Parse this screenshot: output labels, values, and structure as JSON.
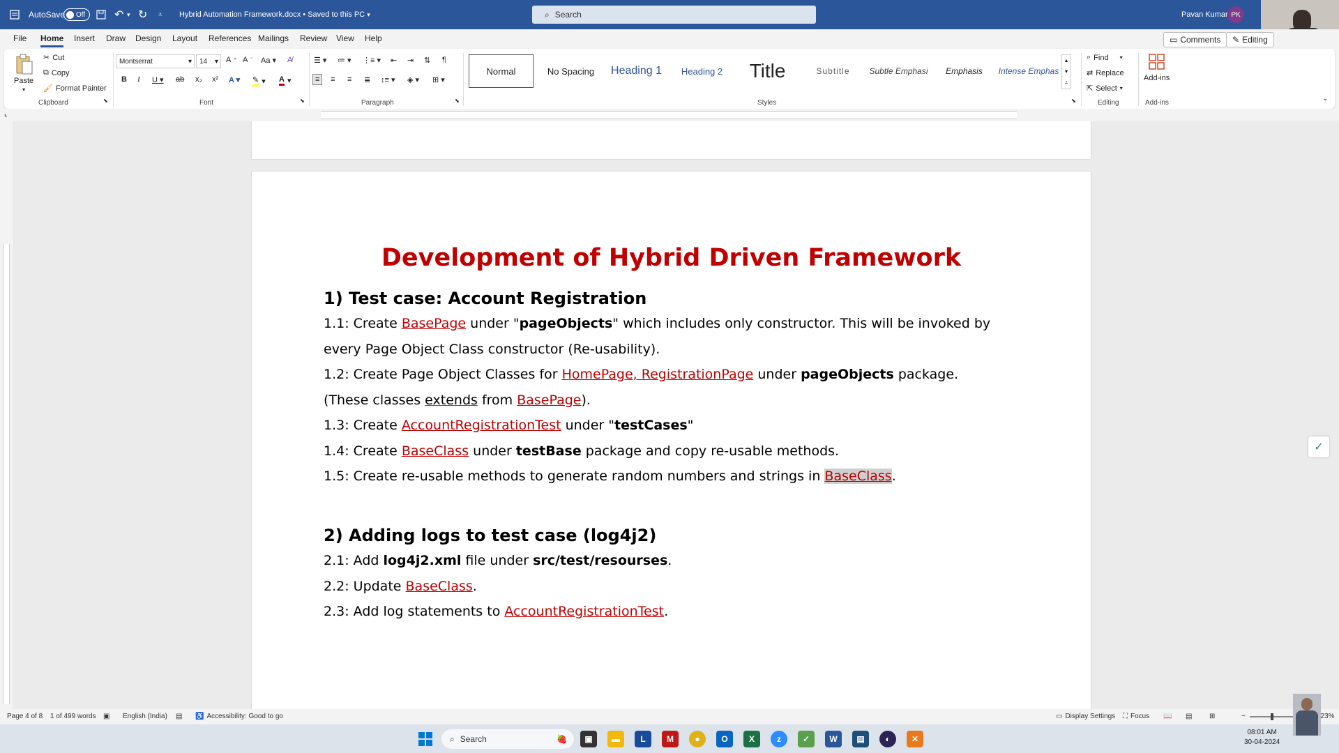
{
  "titlebar": {
    "autosave_label": "AutoSave",
    "autosave_state": "Off",
    "doc_title": "Hybrid Automation Framework.docx • Saved to this PC",
    "search_placeholder": "Search",
    "user_name": "Pavan Kumar",
    "user_initials": "PK"
  },
  "tabs": [
    "File",
    "Home",
    "Insert",
    "Draw",
    "Design",
    "Layout",
    "References",
    "Mailings",
    "Review",
    "View",
    "Help"
  ],
  "active_tab": "Home",
  "top_buttons": {
    "comments": "Comments",
    "editing": "Editing"
  },
  "ribbon": {
    "clipboard": {
      "paste": "Paste",
      "cut": "Cut",
      "copy": "Copy",
      "format_painter": "Format Painter",
      "label": "Clipboard"
    },
    "font": {
      "name": "Montserrat",
      "size": "14",
      "label": "Font"
    },
    "paragraph": {
      "label": "Paragraph"
    },
    "styles": {
      "label": "Styles",
      "items": [
        "Normal",
        "No Spacing",
        "Heading 1",
        "Heading 2",
        "Title",
        "Subtitle",
        "Subtle Emphasi",
        "Emphasis",
        "Intense Emphas"
      ]
    },
    "editing": {
      "find": "Find",
      "replace": "Replace",
      "select": "Select",
      "label": "Editing"
    },
    "addins": {
      "button": "Add-ins",
      "label": "Add-ins"
    }
  },
  "document": {
    "title": "Development of Hybrid Driven Framework",
    "section1_heading": "1) Test case: Account Registration",
    "s1": {
      "l1_a": "1.1: Create ",
      "l1_b": "BasePage",
      "l1_c": " under \"",
      "l1_d": "pageObjects",
      "l1_e": "\" which includes only constructor. This will be invoked by",
      "l2": "every Page Object Class constructor (Re-usability).",
      "l3_a": "1.2: Create Page Object Classes for ",
      "l3_b": "HomePage, RegistrationPage",
      "l3_c": "  under ",
      "l3_d": "pageObjects",
      "l3_e": " package.",
      "l4_a": "(These classes ",
      "l4_b": "extends",
      "l4_c": " from ",
      "l4_d": "BasePage",
      "l4_e": ").",
      "l5_a": "1.3: Create ",
      "l5_b": "AccountRegistrationTest",
      "l5_c": " under \"",
      "l5_d": "testCases",
      "l5_e": "\"",
      "l6_a": "1.4: Create ",
      "l6_b": "BaseClass",
      "l6_c": " under ",
      "l6_d": "testBase",
      "l6_e": " package and copy re-usable methods.",
      "l7_a": "1.5: Create re-usable methods to generate random numbers and strings in ",
      "l7_b": "BaseClass",
      "l7_c": "."
    },
    "section2_heading": "2) Adding logs to test case (log4j2)",
    "s2": {
      "l1_a": "2.1: Add ",
      "l1_b": "log4j2.xml",
      "l1_c": " file under ",
      "l1_d": "src/test/resourses",
      "l1_e": ".",
      "l2_a": "2.2: Update ",
      "l2_b": "BaseClass",
      "l2_c": ".",
      "l3_a": "2.3: Add log statements to ",
      "l3_b": "AccountRegistrationTest",
      "l3_c": "."
    }
  },
  "status": {
    "page": "Page 4 of 8",
    "words": "1 of 499 words",
    "language": "English (India)",
    "accessibility": "Accessibility: Good to go",
    "display_settings": "Display Settings",
    "focus": "Focus",
    "zoom": "123%"
  },
  "taskbar": {
    "search": "Search",
    "time": "08:01 AM",
    "date": "30-04-2024"
  },
  "colors": {
    "word_blue": "#2b579a",
    "heading_red": "#c00000"
  }
}
